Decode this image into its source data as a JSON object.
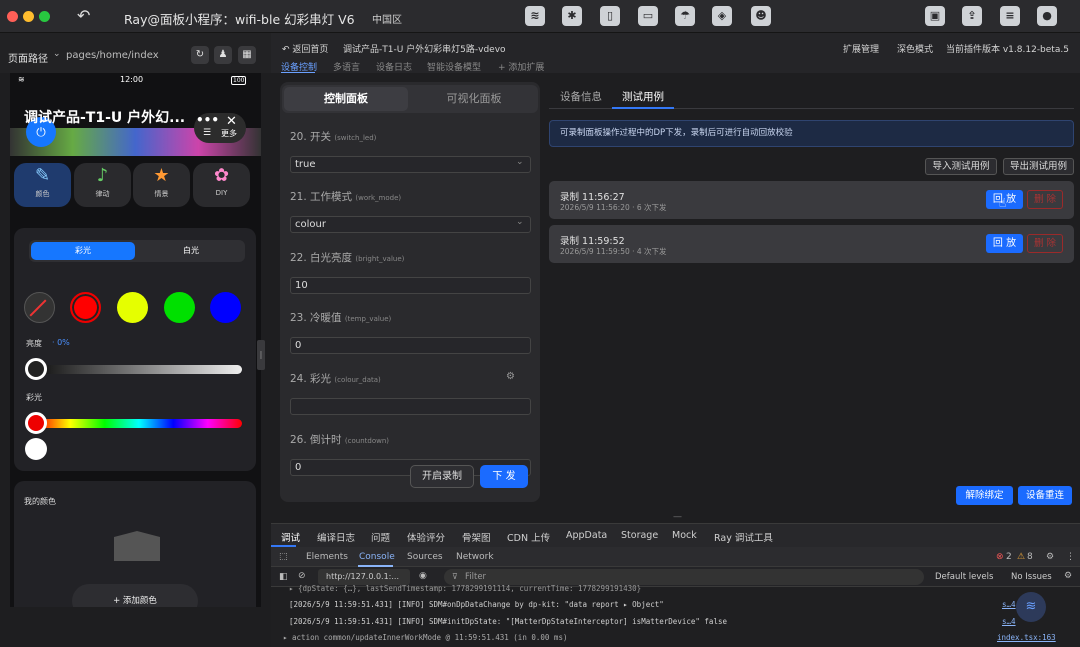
{
  "window": {
    "title": "Ray@面板小程序：wifi-ble 幻彩串灯 V6",
    "region": "中国区"
  },
  "toolbar": {
    "icons": [
      "signal-icon",
      "bug-icon",
      "phone-icon",
      "card-icon",
      "accessibility-icon",
      "cube-icon",
      "robot-icon"
    ],
    "right_icons": [
      "preview-icon",
      "upload-icon",
      "list-icon",
      "user-icon"
    ]
  },
  "pathbar": {
    "label": "页面路径",
    "path": "pages/home/index"
  },
  "phone": {
    "time": "12:00",
    "battery": "100",
    "title": "调试产品-T1-U 户外幻...",
    "more": "更多",
    "scenes": [
      {
        "label": "颜色",
        "icon": "✎"
      },
      {
        "label": "律动",
        "icon": "♪"
      },
      {
        "label": "情景",
        "icon": "★"
      },
      {
        "label": "DIY",
        "icon": "✿"
      }
    ],
    "seg": [
      "彩光",
      "白光"
    ],
    "dots": [
      "#000000",
      "#ff0000",
      "#e5ff00",
      "#00e000",
      "#0000ff"
    ],
    "brightness_label": "亮度",
    "brightness_val": "· 0%",
    "color_label": "彩光",
    "my_color": "我的颜色",
    "add_color": "+ 添加颜色"
  },
  "header": {
    "back": "返回首页",
    "device": "调试产品-T1-U 户外幻彩串灯5路-vdevo",
    "ext": "扩展管理",
    "dark": "深色模式",
    "version": "当前插件版本 v1.8.12-beta.5",
    "tabs": [
      "设备控制",
      "多语言",
      "设备日志",
      "智能设备模型",
      "+ 添加扩展"
    ]
  },
  "control": {
    "tab_a": "控制面板",
    "tab_b": "可视化面板",
    "dps": [
      {
        "label": "20. 开关",
        "code": "(switch_led)",
        "value": "true"
      },
      {
        "label": "21. 工作模式",
        "code": "(work_mode)",
        "value": "colour"
      },
      {
        "label": "22. 白光亮度",
        "code": "(bright_value)",
        "value": "10"
      },
      {
        "label": "23. 冷暖值",
        "code": "(temp_value)",
        "value": "0"
      },
      {
        "label": "24. 彩光",
        "code": "(colour_data)",
        "value": ""
      },
      {
        "label": "26. 倒计时",
        "code": "(countdown)",
        "value": "0"
      }
    ],
    "rec_btn": "开启录制",
    "send_btn": "下 发"
  },
  "right": {
    "tabs": [
      "设备信息",
      "测试用例"
    ],
    "notice": "可录制面板操作过程中的DP下发，录制后可进行自动回放校验",
    "import": "导入测试用例",
    "export": "导出测试用例",
    "records": [
      {
        "title": "录制 11:56:27",
        "sub": "2026/5/9 11:56:20 · 6 次下发"
      },
      {
        "title": "录制 11:59:52",
        "sub": "2026/5/9 11:59:50 · 4 次下发"
      }
    ],
    "play": "回 放",
    "del": "删 除",
    "unbind": "解除绑定",
    "reset": "设备重连"
  },
  "devtools": {
    "tabs": [
      "调试",
      "编译日志",
      "问题",
      "体验评分",
      "骨架图",
      "CDN 上传",
      "AppData",
      "Storage",
      "Mock",
      "Ray 调试工具"
    ],
    "sub": [
      "Elements",
      "Console",
      "Sources",
      "Network"
    ],
    "errors": "2",
    "warnings": "8",
    "url": "http://127.0.0.1:...",
    "filter": "Filter",
    "levels": "Default levels",
    "issues": "No Issues",
    "logs": [
      {
        "text": "▸ {dpState: {…}, lastSendTimestamp: 1778299191114, currentTime: 1778299191430}",
        "src": ""
      },
      {
        "text": "[2026/5/9 11:59:51.431] [INFO] SDM#onDpDataChange by dp-kit: \"data report  ▸ Object\"",
        "src": "s…4"
      },
      {
        "text": "[2026/5/9 11:59:51.431] [INFO] SDM#initDpState: \"[MatterDpStateInterceptor] isMatterDevice\" false",
        "src": "s…4"
      },
      {
        "text": "▸   action common/updateInnerWorkMode @ 11:59:51.431 (in 0.00 ms)",
        "src": "index.tsx:163"
      }
    ]
  }
}
